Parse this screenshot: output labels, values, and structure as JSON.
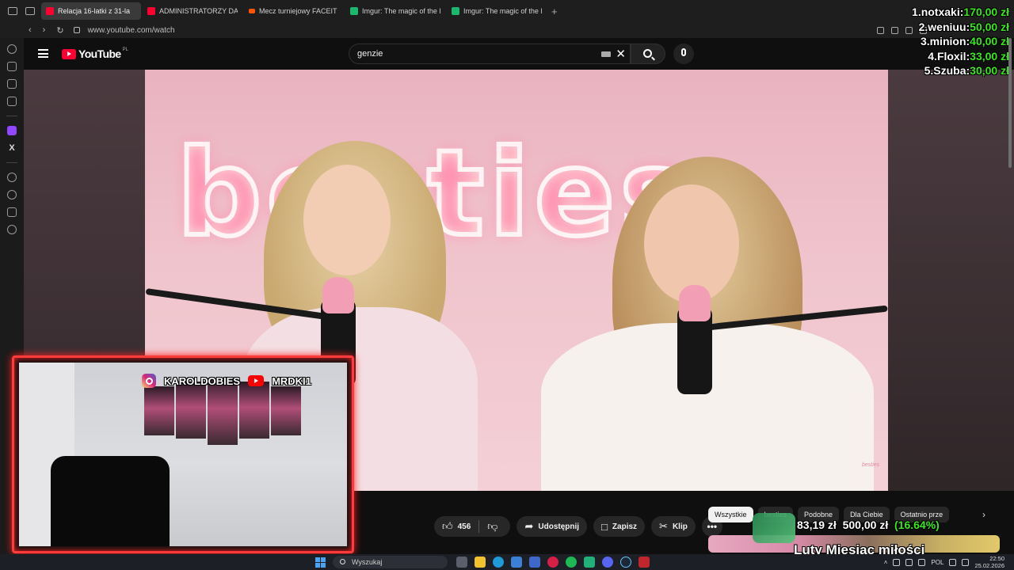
{
  "browser": {
    "tabs": [
      {
        "label": "Relacja 16-latki z 31-la",
        "icon": "youtube-audio-icon",
        "active": true
      },
      {
        "label": "ADMINISTRATORZY DANY",
        "icon": "youtube-icon",
        "active": false
      },
      {
        "label": "Mecz turniejowy FACEIT -",
        "icon": "faceit-icon",
        "active": false
      },
      {
        "label": "Imgur: The magic of the In",
        "icon": "imgur-icon",
        "active": false
      },
      {
        "label": "Imgur: The magic of the In",
        "icon": "imgur-icon",
        "active": false
      }
    ],
    "url": "www.youtube.com/watch"
  },
  "youtube": {
    "logo_text": "YouTube",
    "country_code": "PL",
    "search_query": "genzie",
    "video_badge": "besties",
    "neon_sign": "besties",
    "actions": {
      "likes": "456",
      "share": "Udostępnij",
      "save": "Zapisz",
      "clip": "Klip",
      "more": "•••"
    },
    "chips": [
      "Wszystkie",
      "besties",
      "Podobne",
      "Dla Ciebie",
      "Ostatnio prze"
    ]
  },
  "overlay": {
    "leaderboard": [
      {
        "name": "1.notxaki:",
        "amount": "170,00 zł"
      },
      {
        "name": "2.weniuu:",
        "amount": "50,00 zł"
      },
      {
        "name": "3.minion:",
        "amount": "40,00 zł"
      },
      {
        "name": "4.Floxil:",
        "amount": "33,00 zł"
      },
      {
        "name": "5.Szuba:",
        "amount": "30,00 zł"
      }
    ],
    "socials": {
      "instagram": "KAROLDOBIES",
      "youtube": "MRDKI1"
    },
    "goal": {
      "current": "83,19 zł",
      "target": "500,00 zł",
      "percent": "(16.64%)",
      "progress": 0.1664,
      "title": "Luty Miesiąc miłości"
    }
  },
  "taskbar": {
    "search_placeholder": "Wyszukaj",
    "language": "POL",
    "time": "22:50",
    "date": "25.02.2026"
  },
  "colors": {
    "youtube_red": "#ff0033",
    "leaderboard_amount": "#39e81c",
    "cam_border": "#ff3b3b"
  }
}
